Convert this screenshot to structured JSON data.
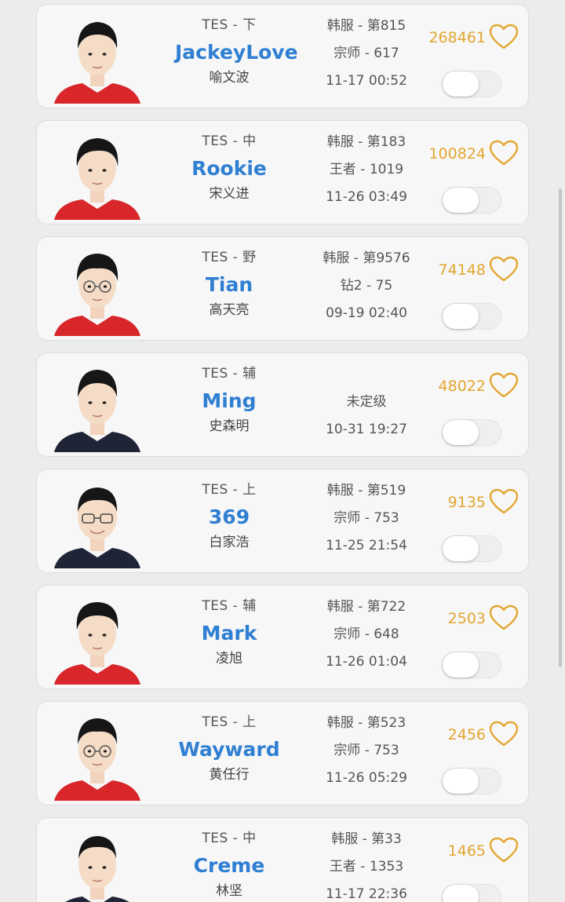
{
  "players": [
    {
      "team_role": "TES - 下",
      "name": "JackeyLove",
      "real_name": "喻文波",
      "server_rank": "韩服 - 第815",
      "tier": "宗师 - 617",
      "time": "11-17 00:52",
      "fans": "268461",
      "jersey": "#d8262a"
    },
    {
      "team_role": "TES - 中",
      "name": "Rookie",
      "real_name": "宋义进",
      "server_rank": "韩服 - 第183",
      "tier": "王者 - 1019",
      "time": "11-26 03:49",
      "fans": "100824",
      "jersey": "#d8262a"
    },
    {
      "team_role": "TES - 野",
      "name": "Tian",
      "real_name": "高天亮",
      "server_rank": "韩服 - 第9576",
      "tier": "钻2 - 75",
      "time": "09-19 02:40",
      "fans": "74148",
      "jersey": "#d8262a"
    },
    {
      "team_role": "TES - 辅",
      "name": "Ming",
      "real_name": "史森明",
      "server_rank": "",
      "tier": "未定级",
      "time": "10-31 19:27",
      "fans": "48022",
      "jersey": "#1f2437"
    },
    {
      "team_role": "TES - 上",
      "name": "369",
      "real_name": "白家浩",
      "server_rank": "韩服 - 第519",
      "tier": "宗师 - 753",
      "time": "11-25 21:54",
      "fans": "9135",
      "jersey": "#1f2437"
    },
    {
      "team_role": "TES - 辅",
      "name": "Mark",
      "real_name": "凌旭",
      "server_rank": "韩服 - 第722",
      "tier": "宗师 - 648",
      "time": "11-26 01:04",
      "fans": "2503",
      "jersey": "#d8262a"
    },
    {
      "team_role": "TES - 上",
      "name": "Wayward",
      "real_name": "黄任行",
      "server_rank": "韩服 - 第523",
      "tier": "宗师 - 753",
      "time": "11-26 05:29",
      "fans": "2456",
      "jersey": "#d8262a"
    },
    {
      "team_role": "TES - 中",
      "name": "Creme",
      "real_name": "林坚",
      "server_rank": "韩服 - 第33",
      "tier": "王者 - 1353",
      "time": "11-17 22:36",
      "fans": "1465",
      "jersey": "#1f2437"
    }
  ],
  "colors": {
    "name_blue": "#2f7fd3",
    "fan_gold": "#e2a630",
    "heart_gold": "#e2a630"
  },
  "icons": {
    "heart": "heart-outline-icon",
    "toggle": "toggle-switch"
  }
}
